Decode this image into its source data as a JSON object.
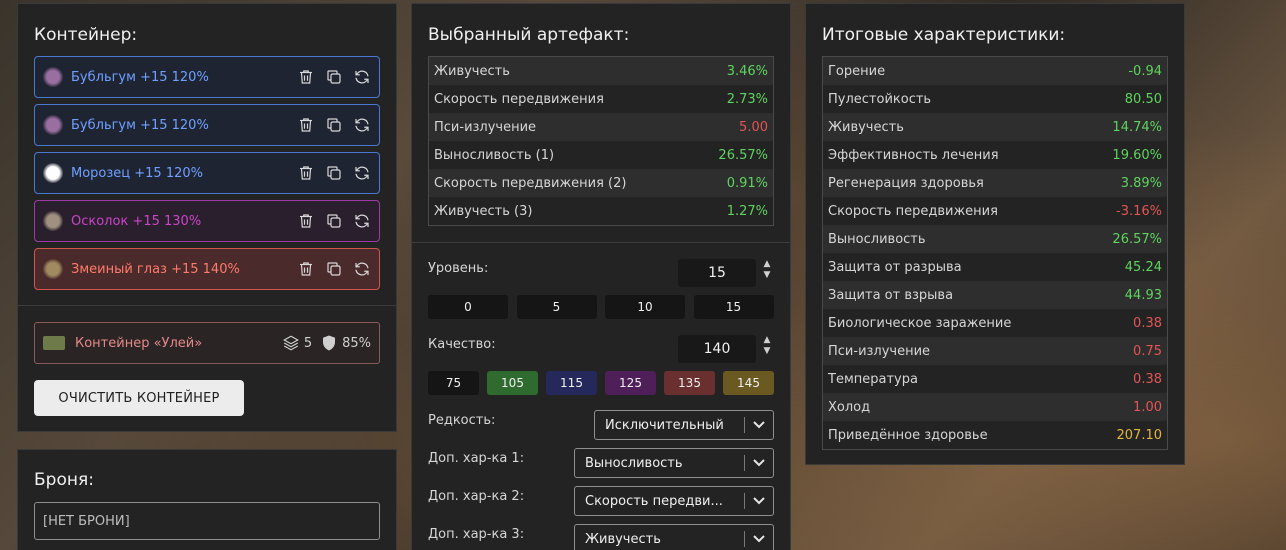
{
  "container": {
    "title": "Контейнер:",
    "items": [
      {
        "label": "Бубльгум +15 120%",
        "color": "#6fa0ff",
        "border": "#4a78d0",
        "bg": "#1f2433",
        "icon": "bubblegum-icon",
        "icon_color": "#9a6fa0"
      },
      {
        "label": "Бубльгум +15 120%",
        "color": "#6fa0ff",
        "border": "#4a78d0",
        "bg": "#1f2433",
        "icon": "bubblegum-icon",
        "icon_color": "#9a6fa0"
      },
      {
        "label": "Морозец +15 120%",
        "color": "#6fa0ff",
        "border": "#4a78d0",
        "bg": "#1f2433",
        "icon": "frost-icon",
        "icon_color": "#ffffff"
      },
      {
        "label": "Осколок +15 130%",
        "color": "#c846c8",
        "border": "#9d3aa8",
        "bg": "#2a1f2d",
        "icon": "shard-icon",
        "icon_color": "#a09080"
      },
      {
        "label": "Змеиный глаз +15 140%",
        "color": "#ff7b6b",
        "border": "#d0564e",
        "bg": "#4a2a2a",
        "icon": "snake-eye-icon",
        "icon_color": "#a08a60"
      }
    ],
    "container_item": {
      "label": "Контейнер «Улей»",
      "slots": "5",
      "protection": "85%"
    },
    "clear_button": "ОЧИСТИТЬ КОНТЕЙНЕР"
  },
  "armor": {
    "title": "Броня:",
    "value": "[НЕТ БРОНИ]"
  },
  "artifact": {
    "title": "Выбранный артефакт:",
    "stats": [
      {
        "label": "Живучесть",
        "value": "3.46%",
        "kind": "pos"
      },
      {
        "label": "Скорость передвижения",
        "value": "2.73%",
        "kind": "pos"
      },
      {
        "label": "Пси-излучение",
        "value": "5.00",
        "kind": "neg"
      },
      {
        "label": "Выносливость (1)",
        "value": "26.57%",
        "kind": "pos"
      },
      {
        "label": "Скорость передвижения (2)",
        "value": "0.91%",
        "kind": "pos"
      },
      {
        "label": "Живучесть (3)",
        "value": "1.27%",
        "kind": "pos"
      }
    ],
    "level_label": "Уровень:",
    "level_value": "15",
    "level_presets": [
      "0",
      "5",
      "10",
      "15"
    ],
    "quality_label": "Качество:",
    "quality_value": "140",
    "quality_presets": [
      {
        "label": "75",
        "color": "#151515"
      },
      {
        "label": "105",
        "color": "#2f6b2f"
      },
      {
        "label": "115",
        "color": "#24285a"
      },
      {
        "label": "125",
        "color": "#4f1f5a"
      },
      {
        "label": "135",
        "color": "#6a2f2f"
      },
      {
        "label": "145",
        "color": "#6a5a22"
      }
    ],
    "rarity_label": "Редкость:",
    "rarity_value": "Исключительный",
    "extra1_label": "Доп. хар-ка 1:",
    "extra1_value": "Выносливость",
    "extra2_label": "Доп. хар-ка 2:",
    "extra2_value": "Скорость передви...",
    "extra3_label": "Доп. хар-ка 3:",
    "extra3_value": "Живучесть"
  },
  "totals": {
    "title": "Итоговые характеристики:",
    "stats": [
      {
        "label": "Горение",
        "value": "-0.94",
        "kind": "pos"
      },
      {
        "label": "Пулестойкость",
        "value": "80.50",
        "kind": "pos"
      },
      {
        "label": "Живучесть",
        "value": "14.74%",
        "kind": "pos"
      },
      {
        "label": "Эффективность лечения",
        "value": "19.60%",
        "kind": "pos"
      },
      {
        "label": "Регенерация здоровья",
        "value": "3.89%",
        "kind": "pos"
      },
      {
        "label": "Скорость передвижения",
        "value": "-3.16%",
        "kind": "neg"
      },
      {
        "label": "Выносливость",
        "value": "26.57%",
        "kind": "pos"
      },
      {
        "label": "Защита от разрыва",
        "value": "45.24",
        "kind": "pos"
      },
      {
        "label": "Защита от взрыва",
        "value": "44.93",
        "kind": "pos"
      },
      {
        "label": "Биологическое заражение",
        "value": "0.38",
        "kind": "neg"
      },
      {
        "label": "Пси-излучение",
        "value": "0.75",
        "kind": "neg"
      },
      {
        "label": "Температура",
        "value": "0.38",
        "kind": "neg"
      },
      {
        "label": "Холод",
        "value": "1.00",
        "kind": "neg"
      },
      {
        "label": "Приведённое здоровье",
        "value": "207.10",
        "kind": "gold"
      }
    ]
  }
}
